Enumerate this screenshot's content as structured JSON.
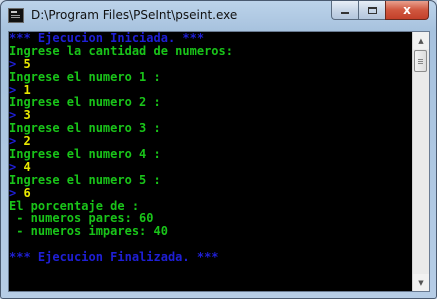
{
  "window": {
    "title": "D:\\Program Files\\PSeInt\\pseint.exe",
    "icon": "console-app-icon",
    "controls": {
      "minimize": "minimize",
      "maximize": "maximize",
      "close": "x"
    }
  },
  "colors": {
    "console_bg": "#000000",
    "banner_blue": "#1f1fd6",
    "prompt_green": "#19c419",
    "input_yellow": "#e8e800"
  },
  "console": {
    "lines": [
      {
        "segments": [
          {
            "text": "*** Ejecucion Iniciada. ***",
            "color": "blue"
          }
        ]
      },
      {
        "segments": [
          {
            "text": "Ingrese la cantidad de numeros:",
            "color": "green"
          }
        ]
      },
      {
        "segments": [
          {
            "text": "> ",
            "color": "cursor"
          },
          {
            "text": "5",
            "color": "yellow"
          }
        ]
      },
      {
        "segments": [
          {
            "text": "Ingrese el numero 1 :",
            "color": "green"
          }
        ]
      },
      {
        "segments": [
          {
            "text": "> ",
            "color": "cursor"
          },
          {
            "text": "1",
            "color": "yellow"
          }
        ]
      },
      {
        "segments": [
          {
            "text": "Ingrese el numero 2 :",
            "color": "green"
          }
        ]
      },
      {
        "segments": [
          {
            "text": "> ",
            "color": "cursor"
          },
          {
            "text": "3",
            "color": "yellow"
          }
        ]
      },
      {
        "segments": [
          {
            "text": "Ingrese el numero 3 :",
            "color": "green"
          }
        ]
      },
      {
        "segments": [
          {
            "text": "> ",
            "color": "cursor"
          },
          {
            "text": "2",
            "color": "yellow"
          }
        ]
      },
      {
        "segments": [
          {
            "text": "Ingrese el numero 4 :",
            "color": "green"
          }
        ]
      },
      {
        "segments": [
          {
            "text": "> ",
            "color": "cursor"
          },
          {
            "text": "4",
            "color": "yellow"
          }
        ]
      },
      {
        "segments": [
          {
            "text": "Ingrese el numero 5 :",
            "color": "green"
          }
        ]
      },
      {
        "segments": [
          {
            "text": "> ",
            "color": "cursor"
          },
          {
            "text": "6",
            "color": "yellow"
          }
        ]
      },
      {
        "segments": [
          {
            "text": "El porcentaje de :",
            "color": "green"
          }
        ]
      },
      {
        "segments": [
          {
            "text": " - numeros pares: 60",
            "color": "green"
          }
        ]
      },
      {
        "segments": [
          {
            "text": " - numeros impares: 40",
            "color": "green"
          }
        ]
      },
      {
        "segments": [
          {
            "text": "",
            "color": "green"
          }
        ]
      },
      {
        "segments": [
          {
            "text": "*** Ejecucion Finalizada. ***",
            "color": "blue"
          }
        ]
      }
    ]
  },
  "scrollbar": {
    "up_icon": "arrow-up-icon",
    "down_icon": "arrow-down-icon"
  }
}
